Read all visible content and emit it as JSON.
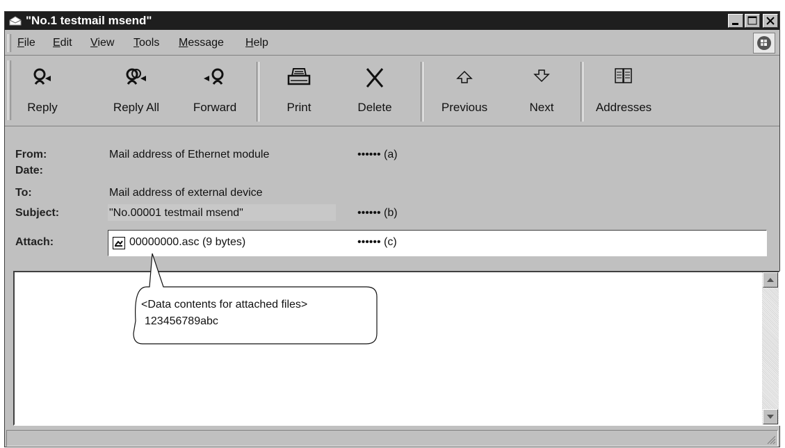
{
  "window": {
    "title": "\"No.1 testmail msend\""
  },
  "menu": {
    "items": [
      {
        "pre": "",
        "key": "F",
        "post": "ile"
      },
      {
        "pre": "",
        "key": "E",
        "post": "dit"
      },
      {
        "pre": "",
        "key": "V",
        "post": "iew"
      },
      {
        "pre": "",
        "key": "T",
        "post": "ools"
      },
      {
        "pre": "",
        "key": "M",
        "post": "essage"
      },
      {
        "pre": "",
        "key": "H",
        "post": "elp"
      }
    ]
  },
  "toolbar": {
    "reply": "Reply",
    "reply_all": "Reply All",
    "forward": "Forward",
    "print": "Print",
    "delete": "Delete",
    "previous": "Previous",
    "next": "Next",
    "addresses": "Addresses"
  },
  "header": {
    "from_label": "From:",
    "from_value": "Mail address of Ethernet module",
    "date_label": "Date:",
    "to_label": "To:",
    "to_value": "Mail address of external device",
    "subject_label": "Subject:",
    "subject_value": "\"No.00001 testmail msend\"",
    "attach_label": "Attach:",
    "attach_value": "00000000.asc (9 bytes)"
  },
  "annotations": {
    "a": "•••••• (a)",
    "b": "•••••• (b)",
    "c": "•••••• (c)"
  },
  "callout": {
    "line1": "<Data contents for attached files>",
    "line2": "123456789abc"
  },
  "colors": {
    "titlebar": "#1e1e1e",
    "face": "#c0c0c0"
  }
}
